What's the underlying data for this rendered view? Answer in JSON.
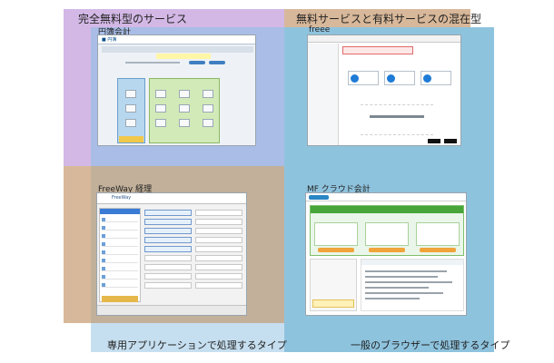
{
  "captions": {
    "free_type": "完全無料型のサービス",
    "mixed_type": "無料サービスと有料サービスの混在型",
    "dedicated_app": "専用アプリケーションで処理するタイプ",
    "browser": "一般のブラウザーで処理するタイプ"
  },
  "apps": {
    "enzou": {
      "title": "円簿会計"
    },
    "freee": {
      "title": "freee"
    },
    "freeway": {
      "title": "FreeWay 経理"
    },
    "mf": {
      "title": "MF クラウド会計"
    }
  },
  "colors": {
    "free_region": "#d3b8e6",
    "mixed_region": "#d8b89a",
    "browser_region": "#8ec3de"
  }
}
